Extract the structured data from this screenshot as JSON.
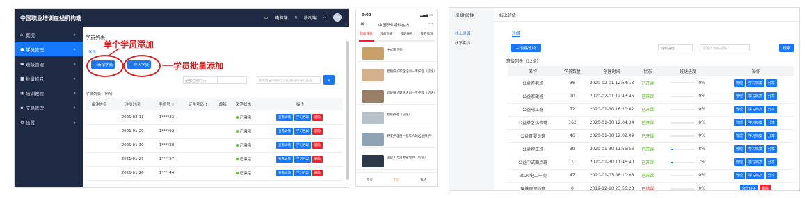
{
  "panel1": {
    "brand": "中国职业培训在线机构端",
    "topbar": {
      "msg": "电脑端",
      "phone": "移动端"
    },
    "sidebar": [
      {
        "label": "概况",
        "icon": "home-icon",
        "active": false
      },
      {
        "label": "学员管理",
        "icon": "user-icon",
        "active": true
      },
      {
        "label": "班级管理",
        "icon": "class-icon",
        "active": false
      },
      {
        "label": "批量报名",
        "icon": "signup-icon",
        "active": false
      },
      {
        "label": "培训教程",
        "icon": "course-icon",
        "active": false
      },
      {
        "label": "交易管理",
        "icon": "trade-icon",
        "active": false
      },
      {
        "label": "设置",
        "icon": "settings-icon",
        "active": false
      }
    ],
    "page_title": "学员列表",
    "subtab": "学员",
    "add_btn": "+ 新增学员",
    "import_btn": "+ 导入学员",
    "annotation_single": "单个学员添加",
    "annotation_batch": "学员批量添加",
    "filter_select": "全部",
    "date_placeholder": "注册时间",
    "search_placeholder": "输入姓名/邮箱/电话/证件号码进行查询",
    "list_title": "学员列表（9条）",
    "columns": [
      "备注姓名",
      "注册时间",
      "手机号 ↕",
      "证件号码 ↕",
      "邮箱",
      "激活状态",
      "操作"
    ],
    "rows": [
      {
        "date": "2021-02-11",
        "phone": "1****33",
        "status": "已激活"
      },
      {
        "date": "2021-01-29",
        "phone": "1****92",
        "status": "已激活"
      },
      {
        "date": "2021-01-30",
        "phone": "1****28",
        "status": "已激活"
      },
      {
        "date": "2021-01-27",
        "phone": "1****57",
        "status": "已激活"
      },
      {
        "date": "2021-01-26",
        "phone": "1****44",
        "status": "已激活"
      }
    ],
    "row_actions": [
      "查看详情",
      "学习档案",
      "删除"
    ]
  },
  "panel2": {
    "time": "9:02",
    "title": "中国职业培训在线",
    "tabs": [
      "我的课程",
      "我的直播",
      "我的报考",
      "我的资源"
    ],
    "items": [
      {
        "title": "中式面点师",
        "color": "#c9a06a"
      },
      {
        "title": "智能照护职业培训—专护理（初级）",
        "color": "#d4b08c"
      },
      {
        "title": "智能照护职业培训—专护理（初级）",
        "color": "#9a7f66"
      },
      {
        "title": "智能养老（初级）",
        "color": "#b7c1c9"
      },
      {
        "title": "养老护理员—老年人的起居照护",
        "color": "#8ea3b3"
      },
      {
        "title": "企业人力资源管理师（初级）",
        "color": "#2d3a4a"
      }
    ],
    "bottom_nav": [
      "首页",
      "学习",
      "我的"
    ]
  },
  "panel3": {
    "header": "班级管理",
    "header_right": "线上班级",
    "side": [
      "线上班级",
      "线下实训"
    ],
    "tab": "班级",
    "create_btn": "+ 创建班级",
    "filter": "班级进度",
    "search_placeholder": "请输入班级名称",
    "search_btn": "搜索",
    "count": "班级列表（12条）",
    "columns": [
      "名称",
      "学员数量",
      "创建时间",
      "状态",
      "班级进度",
      "操作"
    ],
    "rows": [
      {
        "name": "公益养老班",
        "count": "36",
        "time": "2020-02-01 12:54:13",
        "status": "已开课",
        "progress": "0%",
        "pv": 0
      },
      {
        "name": "公益家政班",
        "count": "10",
        "time": "2020-02-01 12:43:46",
        "status": "已开课",
        "progress": "0%",
        "pv": 0
      },
      {
        "name": "公益电工班",
        "count": "72",
        "time": "2020-01-30 16:20:02",
        "status": "已开课",
        "progress": "0%",
        "pv": 0
      },
      {
        "name": "公益茶艺烘焙班",
        "count": "162",
        "time": "2020-01-30 12:04:34",
        "status": "已开课",
        "progress": "0%",
        "pv": 0
      },
      {
        "name": "公益育婴员班",
        "count": "46",
        "time": "2020-01-30 12:02:09",
        "status": "已开课",
        "progress": "0%",
        "pv": 0
      },
      {
        "name": "公益焊工班",
        "count": "39",
        "time": "2020-01-30 11:55:56",
        "status": "已开课",
        "progress": "8%",
        "pv": 8
      },
      {
        "name": "公益中式面点班",
        "count": "111",
        "time": "2020-01-30 11:46:40",
        "status": "已开课",
        "progress": "7%",
        "pv": 7
      },
      {
        "name": "2020电工一期",
        "count": "47",
        "time": "2020-01-03 08:10:08",
        "status": "已开课",
        "progress": "0%",
        "pv": 0
      },
      {
        "name": "保健调理师班",
        "count": "0",
        "time": "2019-12-10 23:56:23",
        "status": "已结课",
        "progress": "0%",
        "pv": 0
      }
    ],
    "actions": [
      "管理",
      "学习档案",
      "分享"
    ],
    "last_actions": [
      "修改班级",
      "删除"
    ]
  }
}
